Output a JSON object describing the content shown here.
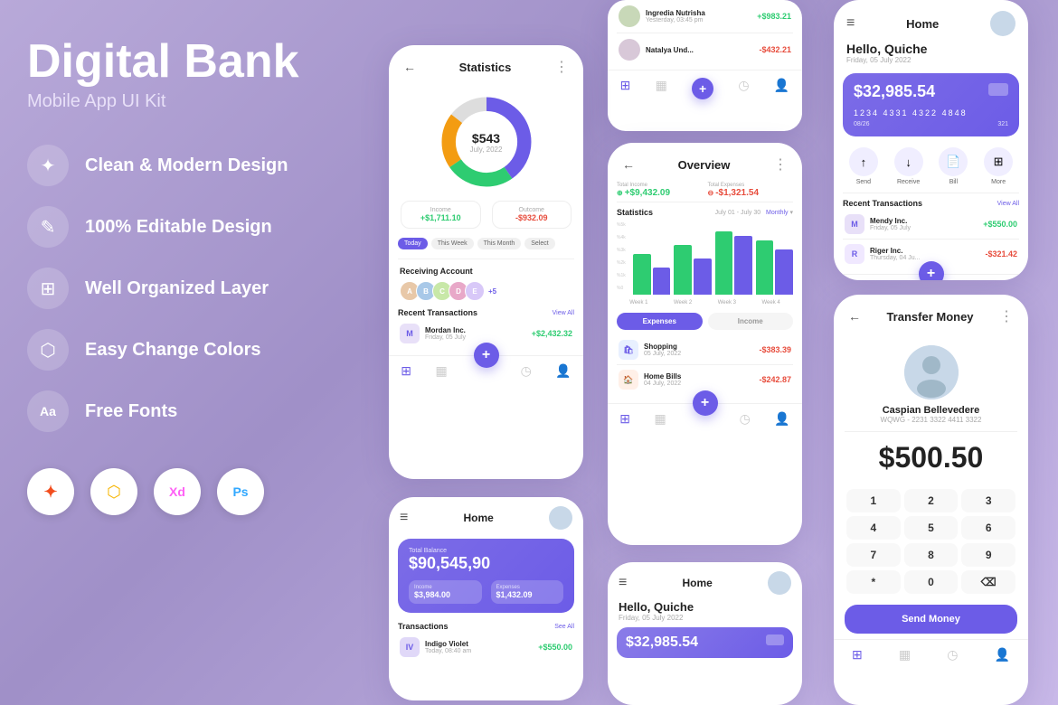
{
  "title": {
    "main": "Digital Bank",
    "sub": "Mobile App UI Kit"
  },
  "features": [
    {
      "id": "clean-modern",
      "icon": "✦",
      "label": "Clean & Modern Design"
    },
    {
      "id": "editable",
      "icon": "✎",
      "label": "100% Editable Design"
    },
    {
      "id": "organized",
      "icon": "⊞",
      "label": "Well Organized Layer"
    },
    {
      "id": "colors",
      "icon": "⬡",
      "label": "Easy Change Colors"
    },
    {
      "id": "fonts",
      "icon": "Aa",
      "label": "Free Fonts"
    }
  ],
  "tools": [
    {
      "id": "figma",
      "label": "Figma"
    },
    {
      "id": "sketch",
      "label": "Sketch"
    },
    {
      "id": "xd",
      "label": "XD"
    },
    {
      "id": "ps",
      "label": "Ps"
    }
  ],
  "stats_phone": {
    "header": "Statistics",
    "donut_amount": "$543",
    "donut_date": "July, 2022",
    "income_label": "Income",
    "income_value": "+$1,711.10",
    "outcome_label": "Outcome",
    "outcome_value": "-$932.09",
    "tabs": [
      "Today",
      "This Week",
      "This Month",
      "Select"
    ],
    "receiving_account_label": "Receiving Account",
    "avatar_count": "+5",
    "recent_transactions_label": "Recent Transactions",
    "view_all": "View All",
    "transaction": {
      "name": "Mordan Inc.",
      "date": "Friday, 05 July",
      "amount": "+$2,432.32"
    }
  },
  "overview_phone": {
    "header": "Overview",
    "total_income_label": "Total Income",
    "total_income": "+$9,432.09",
    "total_expense_label": "Total Expenses",
    "total_expense": "-$1,321.54",
    "statistics_label": "Statistics",
    "date_range": "July 01 - July 30",
    "period": "Monthly",
    "y_labels": [
      "%5k",
      "%4k",
      "%3k",
      "%2k",
      "%1k",
      "%0"
    ],
    "x_labels": [
      "Week 1",
      "Week 2",
      "Week 3",
      "Week 4"
    ],
    "toggle_expenses": "Expenses",
    "toggle_income": "Income",
    "expense_items": [
      {
        "name": "Shopping",
        "date": "05 July, 2022",
        "amount": "-$383.39"
      },
      {
        "name": "Home Bills",
        "date": "04 July, 2022",
        "amount": "-$242.87"
      }
    ]
  },
  "txlist_phone": {
    "transactions": [
      {
        "name": "Ingredia Nutrisha",
        "date": "Yesterday, 03:45 pm",
        "amount": "+$983.21"
      },
      {
        "name": "Natalya Und...",
        "date": "",
        "amount": "-$432.21"
      }
    ]
  },
  "home_bottom_phone": {
    "menu_icon": "≡",
    "title": "Home",
    "total_balance_label": "Total Balance",
    "total_balance": "$90,545,90",
    "income_label": "Income",
    "income_value": "$3,984.00",
    "expenses_label": "Expenses",
    "expenses_value": "$1,432.09",
    "transactions_label": "Transactions",
    "see_all": "See All",
    "transaction": {
      "name": "Indigo Violet",
      "date": "Today, 08:40 am",
      "amount": "+$550.00"
    }
  },
  "home_right_phone": {
    "menu_icon": "≡",
    "title": "Home",
    "hello": "Hello, Quiche",
    "date": "Friday, 05 July 2022",
    "balance": "$32,985.54",
    "card_number": "1234   4331   4322   4848",
    "card_expiry": "08/26",
    "card_cvv": "321",
    "actions": [
      "Send",
      "Receive",
      "Bill",
      "More"
    ],
    "recent_transactions": "Recent Transactions",
    "view_all": "View All",
    "transactions": [
      {
        "name": "Mendy Inc.",
        "date": "Friday, 05 July",
        "amount": "+$550.00"
      },
      {
        "name": "Riger Inc.",
        "date": "Thursday, 04 Ju...",
        "amount": "-$321.42"
      }
    ]
  },
  "home2_phone": {
    "menu_icon": "≡",
    "title": "Home",
    "hello": "Hello, Quiche",
    "date": "Friday, 05 July 2022",
    "balance": "$32,985.54"
  },
  "transfer_phone": {
    "back_icon": "←",
    "title": "Transfer Money",
    "dots_icon": "⋮",
    "person_name": "Caspian Bellevedere",
    "person_account": "WQWG - 2231 3322 4411 3322",
    "amount": "$500.50",
    "keypad": [
      "1",
      "2",
      "3",
      "4",
      "5",
      "6",
      "7",
      "8",
      "9",
      "*",
      "0",
      "⌫"
    ],
    "send_label": "Send Money"
  },
  "colors": {
    "purple": "#6c5ce7",
    "purple_light": "#8a7ce8",
    "green": "#2ecc71",
    "red": "#e74c3c",
    "background_start": "#b8a9d9",
    "background_end": "#a090c8"
  }
}
